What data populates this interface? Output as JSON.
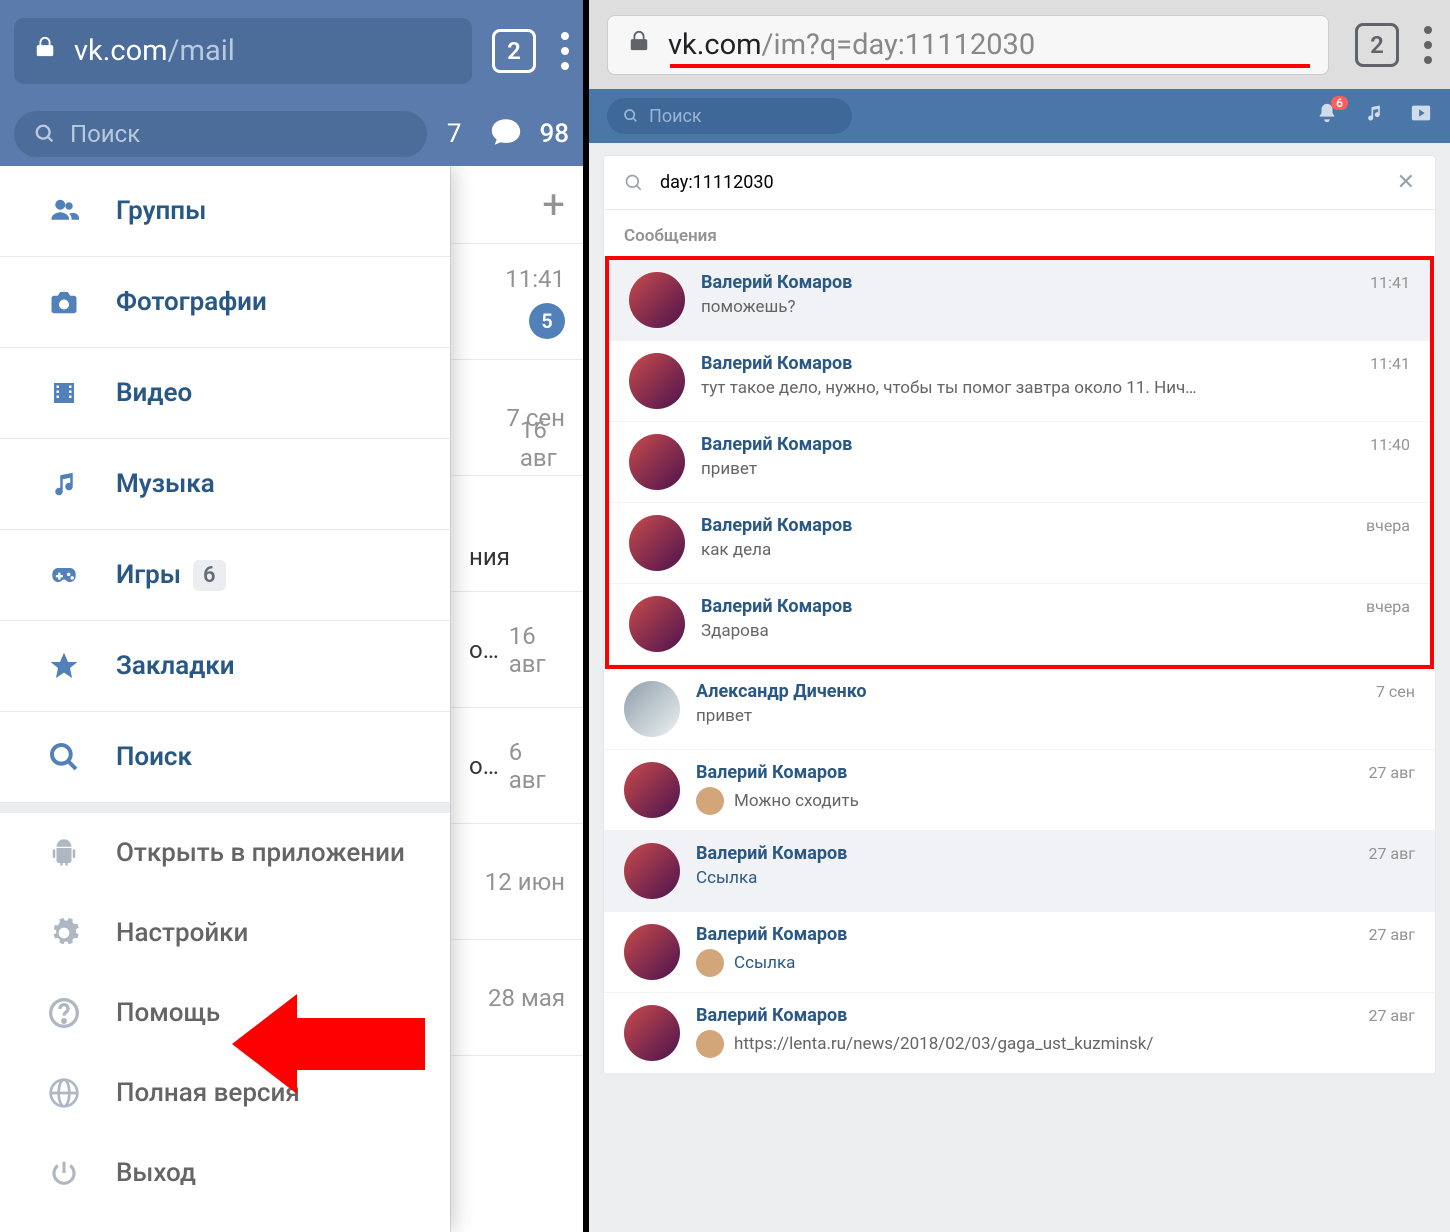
{
  "left": {
    "chrome": {
      "tabs": "2",
      "url_prefix": "vk.com",
      "url_path": "/mail"
    },
    "header": {
      "search_placeholder": "Поиск",
      "left_count": "7",
      "msg_count": "98"
    },
    "nav_main": [
      {
        "label": "Группы",
        "icon": "groups"
      },
      {
        "label": "Фотографии",
        "icon": "camera"
      },
      {
        "label": "Видео",
        "icon": "film"
      },
      {
        "label": "Музыка",
        "icon": "music"
      },
      {
        "label": "Игры",
        "icon": "gamepad",
        "badge": "6"
      },
      {
        "label": "Закладки",
        "icon": "star"
      },
      {
        "label": "Поиск",
        "icon": "search"
      }
    ],
    "nav_secondary": [
      {
        "label": "Открыть в приложении",
        "icon": "android"
      },
      {
        "label": "Настройки",
        "icon": "gear"
      },
      {
        "label": "Помощь",
        "icon": "help"
      },
      {
        "label": "Полная версия",
        "icon": "globe"
      },
      {
        "label": "Выход",
        "icon": "power"
      }
    ],
    "bg": {
      "r0_time": "11:41",
      "r0_badge": "5",
      "r1": "7 сен",
      "r2": "16 авг",
      "r2_txt": "ния",
      "r3": "16 авг",
      "r3_txt": "о…",
      "r4": "6 авг",
      "r4_txt": "о…",
      "r5": "12 июн",
      "r6": "28 мая"
    }
  },
  "right": {
    "chrome": {
      "tabs": "2",
      "url_prefix": "vk.com",
      "url_path": "/im?q=day:11112030"
    },
    "top": {
      "search_placeholder": "Поиск",
      "bell_count": "6"
    },
    "search_value": "day:11112030",
    "section_title": "Сообщения",
    "messages": [
      {
        "name": "Валерий Комаров",
        "time": "11:41",
        "text": "поможешь?",
        "hi": true
      },
      {
        "name": "Валерий Комаров",
        "time": "11:41",
        "text": "тут такое дело, нужно, чтобы ты помог завтра около 11. Нич…"
      },
      {
        "name": "Валерий Комаров",
        "time": "11:40",
        "text": "привет"
      },
      {
        "name": "Валерий Комаров",
        "time": "вчера",
        "text": "как дела"
      },
      {
        "name": "Валерий Комаров",
        "time": "вчера",
        "text": "Здарова"
      }
    ],
    "messages_after": [
      {
        "name": "Александр Диченко",
        "time": "7 сен",
        "text": "привет",
        "av": "av2"
      },
      {
        "name": "Валерий Комаров",
        "time": "27 авг",
        "text": "Можно сходить",
        "mini": true
      },
      {
        "name": "Валерий Комаров",
        "time": "27 авг",
        "text": "Ссылка",
        "link": true,
        "hi": true
      },
      {
        "name": "Валерий Комаров",
        "time": "27 авг",
        "text": "Ссылка",
        "link": true,
        "mini": true
      },
      {
        "name": "Валерий Комаров",
        "time": "27 авг",
        "text": "https://lenta.ru/news/2018/02/03/gaga_ust_kuzminsk/",
        "mini": true
      }
    ]
  }
}
